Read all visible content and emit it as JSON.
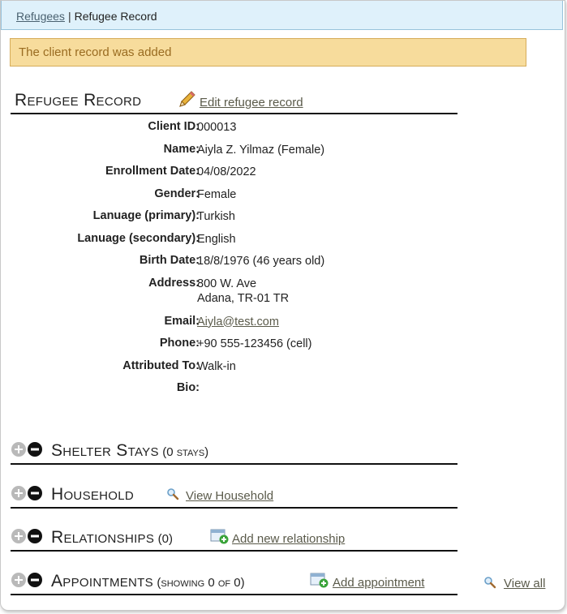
{
  "breadcrumb": {
    "parent": "Refugees",
    "separator": "|",
    "current": "Refugee Record"
  },
  "notice": {
    "message": "The client record was added"
  },
  "record": {
    "title": "Refugee Record",
    "edit_link": "Edit refugee record",
    "fields": [
      {
        "label": "Client ID:",
        "value": "000013"
      },
      {
        "label": "Name:",
        "value": "Aiyla Z. Yilmaz (Female)"
      },
      {
        "label": "Enrollment Date:",
        "value": "04/08/2022"
      },
      {
        "label": "Gender:",
        "value": "Female"
      },
      {
        "label": "Lanuage (primary):",
        "value": "Turkish"
      },
      {
        "label": "Lanuage (secondary):",
        "value": "English"
      },
      {
        "label": "Birth Date:",
        "value": "18/8/1976 (46 years old)"
      },
      {
        "label": "Address:",
        "value_line1": "800 W. Ave",
        "value_line2": "Adana, TR-01 TR"
      },
      {
        "label": "Email:",
        "value": "Aiyla@test.com"
      },
      {
        "label": "Phone:",
        "value": "+90 555-123456 (cell)"
      },
      {
        "label": "Attributed To:",
        "value": "Walk-in"
      },
      {
        "label": "Bio:",
        "value": ""
      }
    ]
  },
  "sections": {
    "shelter": {
      "title": "Shelter Stays",
      "count": "(0 stays)"
    },
    "household": {
      "title": "Household",
      "link": "View Household"
    },
    "relationships": {
      "title": "Relationships",
      "count": "(0)",
      "link": "Add new relationship"
    },
    "appointments": {
      "title": "Appointments",
      "count": "(showing 0 of 0)",
      "link": "Add appointment",
      "view_all": "View all"
    }
  },
  "icons": {
    "toggle": "plus-minus-toggle-icon",
    "edit": "pencil-icon",
    "search": "magnifier-icon",
    "add": "calendar-add-icon"
  }
}
